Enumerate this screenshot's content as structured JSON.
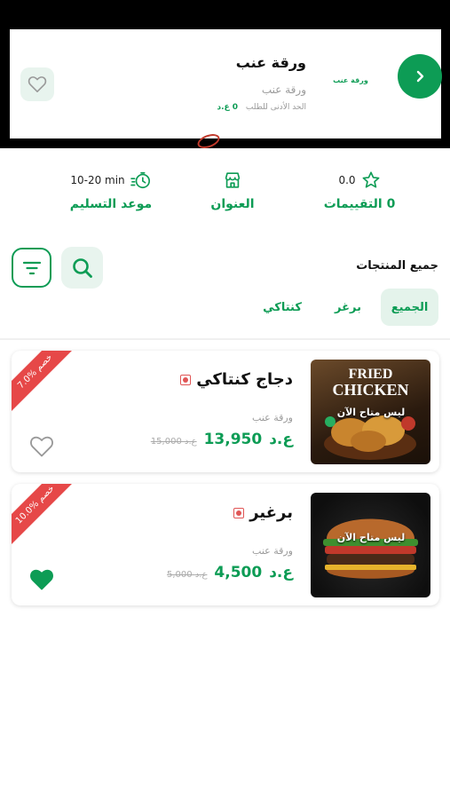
{
  "store": {
    "name": "ورقة عنب",
    "subtitle": "ورقة عنب",
    "min_order_label": "الحد الأدنى للطلب",
    "min_order_value": "0 ع.د",
    "logo_text": "ورقة عنب"
  },
  "info": {
    "rating_value": "0.0",
    "rating_label": "0 التقييمات",
    "address_label": "العنوان",
    "delivery_value": "10-20 min",
    "delivery_label": "موعد التسليم"
  },
  "section_title": "جميع المنتجات",
  "tabs": [
    {
      "label": "الجميع",
      "active": true
    },
    {
      "label": "برغر",
      "active": false
    },
    {
      "label": "كنتاكي",
      "active": false
    }
  ],
  "products": [
    {
      "name": "دجاج كنتاكي",
      "store": "ورقة عنب",
      "price": "13,950",
      "currency": "ع.د",
      "old_price": "15,000 ع.د",
      "discount": "7.0% خصم",
      "availability": "ليس متاح الآن",
      "image_text_1": "FRIED",
      "image_text_2": "CHICKEN",
      "favorite": false
    },
    {
      "name": "برغير",
      "store": "ورقة عنب",
      "price": "4,500",
      "currency": "ع.د",
      "old_price": "5,000 ع.د",
      "discount": "10.0% خصم",
      "availability": "ليس متاح الآن",
      "favorite": true
    }
  ],
  "colors": {
    "accent": "#0d9c55",
    "ribbon": "#e64848",
    "tab_bg": "#e4f3eb"
  },
  "icons": {
    "next": "chevron-right-icon",
    "favorite": "heart-icon",
    "rating": "star-icon",
    "address": "store-icon",
    "delivery": "timer-icon",
    "filter": "filter-icon",
    "search": "search-icon"
  }
}
